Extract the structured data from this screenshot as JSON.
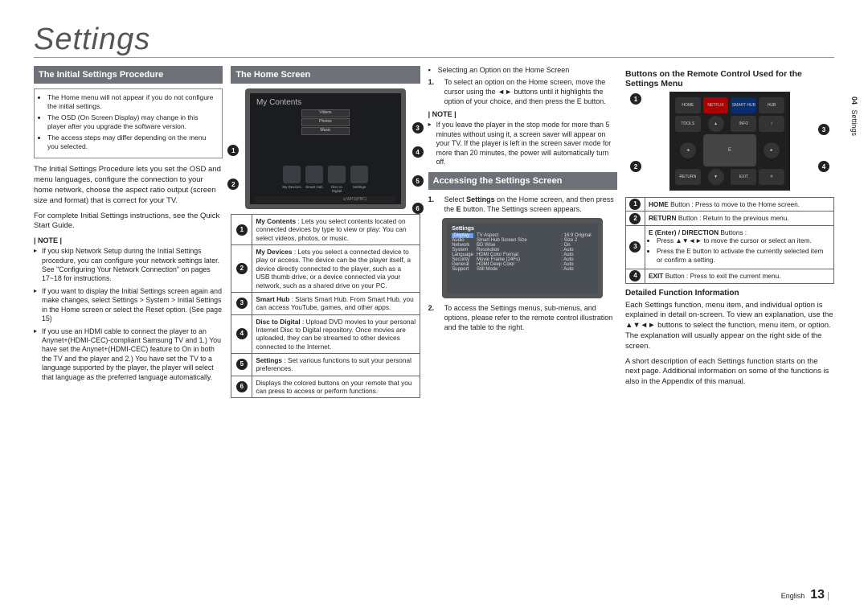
{
  "page_title": "Settings",
  "side_tab": {
    "num": "04",
    "label": "Settings"
  },
  "footer": {
    "lang": "English",
    "page": "13"
  },
  "col1": {
    "header": "The Initial Settings Procedure",
    "box_items": [
      "The Home menu will not appear if you do not configure the initial settings.",
      "The OSD (On Screen Display) may change in this player after you upgrade the software version.",
      "The access steps may differ depending on the menu you selected."
    ],
    "para1": "The Initial Settings Procedure lets you set the OSD and menu languages, configure the connection to your home network, choose the aspect ratio output (screen size and format) that is correct for your TV.",
    "para2": "For complete Initial Settings instructions, see the Quick Start Guide.",
    "note_label": "| NOTE |",
    "notes": [
      "If you skip Network Setup during the Initial Settings procedure, you can configure your network settings later. See \"Configuring Your Network Connection\" on pages 17~18 for instructions.",
      "If you want to display the Initial Settings screen again and make changes, select Settings > System > Initial Settings in the Home screen or select the Reset option. (See page 15)",
      "If you use an HDMI cable to connect the player to an Anynet+(HDMI-CEC)-compliant Samsung TV and 1.) You have set the Anynet+(HDMI-CEC) feature to On in both the TV and the player and 2.) You have set the TV to a language supported by the player, the player will select that language as the preferred language automatically."
    ]
  },
  "col2": {
    "header": "The Home Screen",
    "tv": {
      "title": "My Contents",
      "cards": [
        "Videos",
        "Photos",
        "Music"
      ],
      "icons": [
        "My Devices",
        "Smart Hub",
        "Disc to Digital",
        "Settings"
      ],
      "bar": "a WPS(PBC)"
    },
    "callouts": [
      "1",
      "2",
      "3",
      "4",
      "5",
      "6"
    ],
    "rows": [
      {
        "n": "1",
        "t": "<b>My Contents</b> : Lets you select contents located on connected devices by type to view or play: You can select videos, photos, or music."
      },
      {
        "n": "2",
        "t": "<b>My Devices</b> : Lets you select a connected device to play or access. The device can be the player itself, a device directly connected to the player, such as a USB thumb drive, or a device connected via your network, such as a shared drive on your PC."
      },
      {
        "n": "3",
        "t": "<b>Smart Hub</b> : Starts Smart Hub. From Smart Hub, you can access YouTube, games, and other apps."
      },
      {
        "n": "4",
        "t": "<b>Disc to Digital</b> : Upload DVD movies to your personal Internet Disc to Digital repository. Once movies are uploaded, they can be streamed to other devices connected to the Internet."
      },
      {
        "n": "5",
        "t": "<b>Settings</b> : Set various functions to suit your personal preferences."
      },
      {
        "n": "6",
        "t": "Displays the colored buttons on your remote that you can press to access or perform functions."
      }
    ]
  },
  "col3": {
    "sel_title": "Selecting an Option on the Home Screen",
    "sel_steps": [
      "To select an option on the Home screen, move the cursor using the ◄► buttons until it highlights the option of your choice, and then press the E button."
    ],
    "note_label": "| NOTE |",
    "note1": "If you leave the player in the stop mode for more than 5 minutes without using it, a screen saver will appear on your TV. If the player is left in the screen saver mode for more than 20 minutes, the power will automatically turn off.",
    "header": "Accessing the Settings Screen",
    "step1": "Select Settings on the Home screen, and then press the E button. The Settings screen appears.",
    "settings_shot": {
      "title": "Settings",
      "side": [
        "Display",
        "Audio",
        "Network",
        "System",
        "Language",
        "Security",
        "General",
        "Support"
      ],
      "rows": [
        {
          "l": "TV Aspect",
          "v": ": 16:9 Original"
        },
        {
          "l": "Smart Hub Screen Size",
          "v": ": Size 2"
        },
        {
          "l": "BD Wise",
          "v": ": On"
        },
        {
          "l": "Resolution",
          "v": ": Auto"
        },
        {
          "l": "HDMI Color Format",
          "v": ": Auto"
        },
        {
          "l": "Movie Frame (24Fs)",
          "v": ": Auto"
        },
        {
          "l": "HDMI Deep Color",
          "v": ": Auto"
        },
        {
          "l": "Still Mode",
          "v": ": Auto"
        }
      ]
    },
    "step2": "To access the Settings menus, sub-menus, and options, please refer to the remote control illustration and the table to the right."
  },
  "col4": {
    "header": "Buttons on the Remote Control Used for the Settings Menu",
    "remote_labels": {
      "home": "HOME",
      "smart": "SMART HUB",
      "netflix": "NETFLIX",
      "tools": "TOOLS",
      "info": "INFO",
      "return": "RETURN",
      "exit": "EXIT"
    },
    "callouts": [
      "1",
      "2",
      "3",
      "4"
    ],
    "legend": [
      {
        "n": "1",
        "t": "<b>HOME</b> Button : Press to move to the Home screen."
      },
      {
        "n": "2",
        "t": "<b>RETURN</b> Button : Return to the previous menu."
      },
      {
        "n": "3",
        "t": "<b>E (Enter) / DIRECTION</b> Buttons :",
        "sub": [
          "Press ▲▼◄► to move the cursor or select an item.",
          "Press the E button to activate the currently selected item or confirm a setting."
        ]
      },
      {
        "n": "4",
        "t": "<b>EXIT</b> Button : Press to exit the current menu."
      }
    ],
    "dfi_title": "Detailed Function Information",
    "dfi_p1": "Each Settings function, menu item, and individual option is explained in detail on-screen. To view an explanation, use the ▲▼◄► buttons to select the function, menu item, or option. The explanation will usually appear on the right side of the screen.",
    "dfi_p2": "A short description of each Settings function starts on the next page. Additional information on some of the functions is also in the Appendix of this manual."
  }
}
